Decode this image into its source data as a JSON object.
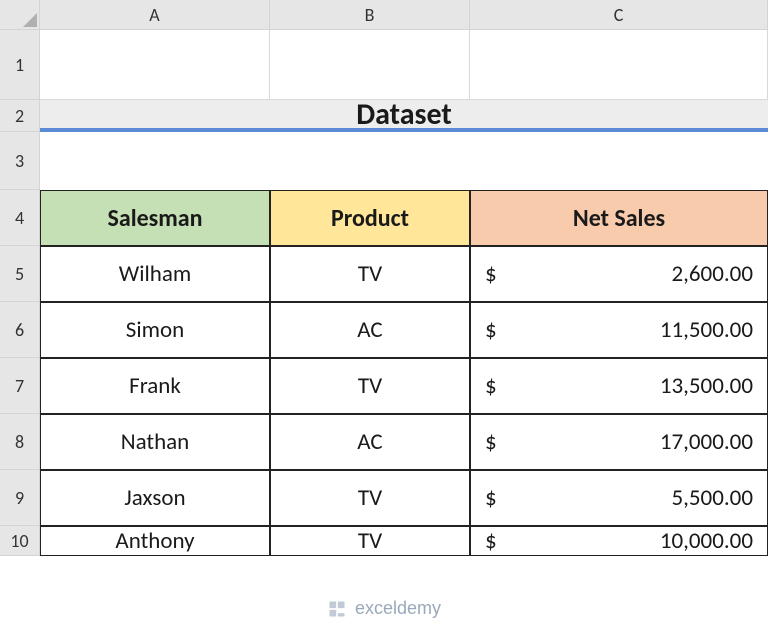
{
  "columns": [
    "A",
    "B",
    "C"
  ],
  "rows": [
    "1",
    "2",
    "3",
    "4",
    "5",
    "6",
    "7",
    "8",
    "9",
    "10"
  ],
  "title": "Dataset",
  "headers": {
    "a": "Salesman",
    "b": "Product",
    "c": "Net Sales"
  },
  "data": [
    {
      "salesman": "Wilham",
      "product": "TV",
      "sym": "$",
      "sales": "2,600.00"
    },
    {
      "salesman": "Simon",
      "product": "AC",
      "sym": "$",
      "sales": "11,500.00"
    },
    {
      "salesman": "Frank",
      "product": "TV",
      "sym": "$",
      "sales": "13,500.00"
    },
    {
      "salesman": "Nathan",
      "product": "AC",
      "sym": "$",
      "sales": "17,000.00"
    },
    {
      "salesman": "Jaxson",
      "product": "TV",
      "sym": "$",
      "sales": "5,500.00"
    },
    {
      "salesman": "Anthony",
      "product": "TV",
      "sym": "$",
      "sales": "10,000.00"
    }
  ],
  "watermark": "exceldemy",
  "chart_data": {
    "type": "table",
    "title": "Dataset",
    "columns": [
      "Salesman",
      "Product",
      "Net Sales"
    ],
    "rows": [
      [
        "Wilham",
        "TV",
        2600.0
      ],
      [
        "Simon",
        "AC",
        11500.0
      ],
      [
        "Frank",
        "TV",
        13500.0
      ],
      [
        "Nathan",
        "AC",
        17000.0
      ],
      [
        "Jaxson",
        "TV",
        5500.0
      ],
      [
        "Anthony",
        "TV",
        10000.0
      ]
    ]
  }
}
